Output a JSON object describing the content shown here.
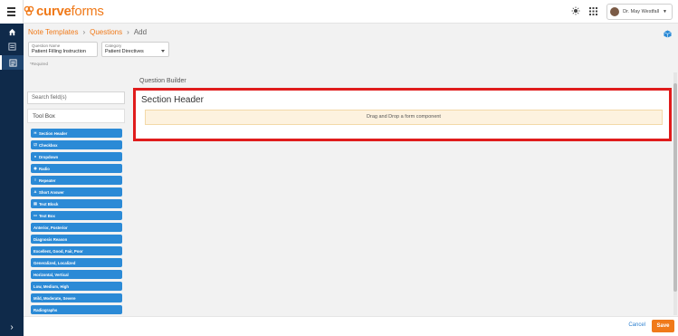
{
  "app": {
    "brand_a": "curve",
    "brand_b": "forms"
  },
  "header": {
    "user_name": "Dr. May Westfall"
  },
  "breadcrumb": {
    "item1": "Note Templates",
    "item2": "Questions",
    "current": "Add"
  },
  "form": {
    "question_name_label": "Question Name",
    "question_name_value": "Patient Filling Instruction",
    "category_label": "Category",
    "category_value": "Patient Directives",
    "required_note": "*Required"
  },
  "sidebar": {
    "search_placeholder": "Search field(s)",
    "toolbox_title": "Tool Box",
    "tools": [
      {
        "label": "Section Header",
        "icon": "H"
      },
      {
        "label": "Checkbox",
        "icon": "☑"
      },
      {
        "label": "Dropdown",
        "icon": "●"
      },
      {
        "label": "Radio",
        "icon": "◉"
      },
      {
        "label": "Repeater",
        "icon": "≡"
      },
      {
        "label": "Short Answer",
        "icon": "A"
      },
      {
        "label": "Text Block",
        "icon": "▤"
      },
      {
        "label": "Text Box",
        "icon": "▭"
      },
      {
        "label": "Anterior, Posterior",
        "icon": ""
      },
      {
        "label": "Diagnosis Reason",
        "icon": ""
      },
      {
        "label": "Excellent, Good, Fair, Poor",
        "icon": ""
      },
      {
        "label": "Generalized, Localized",
        "icon": ""
      },
      {
        "label": "Horizontal, Vertical",
        "icon": ""
      },
      {
        "label": "Low, Medium, High",
        "icon": ""
      },
      {
        "label": "Mild, Moderate, Severe",
        "icon": ""
      },
      {
        "label": "Radiographs",
        "icon": ""
      }
    ]
  },
  "builder": {
    "title": "Question Builder",
    "section_title": "Section Header",
    "dropzone_text": "Drag and Drop a form component"
  },
  "footer": {
    "cancel_label": "Cancel",
    "save_label": "Save"
  },
  "colors": {
    "accent": "#f07a1a",
    "nav": "#0f2a4a",
    "tool": "#2b8ad6",
    "highlight": "#e01c1c"
  }
}
